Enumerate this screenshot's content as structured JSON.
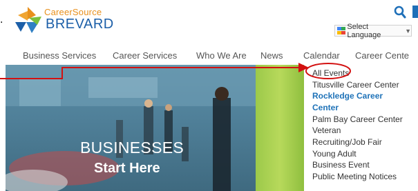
{
  "logo": {
    "line1": "CareerSource",
    "line2": "BREVARD",
    "colors": {
      "orange": "#e8901c",
      "blue": "#1c5fa8",
      "green": "#7bbf3b"
    }
  },
  "header": {
    "search_icon": "search-icon",
    "language_select": {
      "label": "Select Language",
      "arrow": "▼"
    }
  },
  "nav": {
    "items": [
      "Business Services",
      "Career Services",
      "Who We Are",
      "News",
      "Calendar",
      "Career Cente"
    ]
  },
  "hero": {
    "title": "BUSINESSES",
    "subtitle": "Start Here"
  },
  "calendar_menu": {
    "items": [
      "All Events",
      "Titusville Career Center",
      "Rockledge Career",
      "Center",
      "Palm Bay Career Center",
      "Veteran",
      "Recruiting/Job Fair",
      "Young Adult",
      "Business Event",
      "Public Meeting Notices"
    ]
  },
  "annotation": {
    "dot": ".",
    "color": "#d31010"
  }
}
